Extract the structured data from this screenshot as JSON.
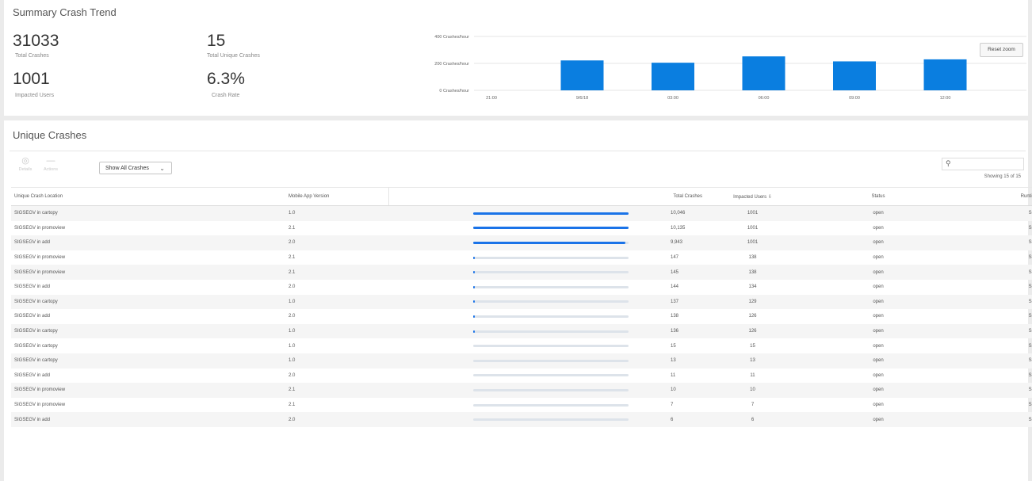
{
  "summary": {
    "title": "Summary Crash Trend",
    "stats": {
      "total_crashes": {
        "value": "31033",
        "label": "Total Crashes"
      },
      "unique_crashes": {
        "value": "15",
        "label": "Total Unique Crashes"
      },
      "impacted_users": {
        "value": "1001",
        "label": "Impacted Users"
      },
      "crash_rate": {
        "value": "6.3%",
        "label": "Crash Rate"
      }
    },
    "reset_zoom_label": "Reset zoom"
  },
  "chart_data": {
    "type": "bar",
    "title": "",
    "categories": [
      "9/6/18",
      "03:00",
      "06:00",
      "09:00",
      "12:00"
    ],
    "x_tick_labels": [
      "21:00",
      "9/6/18",
      "03:00",
      "06:00",
      "09:00",
      "12:00"
    ],
    "y_tick_labels": [
      "400 Crashes/hour",
      "200 Crashes/hour",
      "0 Crashes/hour"
    ],
    "values": [
      222,
      205,
      252,
      215,
      230
    ],
    "ylim": [
      0,
      400
    ],
    "grid": true,
    "bar_color": "#0a7ee0"
  },
  "crashes": {
    "title": "Unique Crashes",
    "toolbar": {
      "details_label": "Details",
      "actions_label": "Actions",
      "filter_label": "Show All Crashes",
      "search_placeholder": "",
      "showing_text": "Showing 15 of 15"
    },
    "columns": {
      "location": "Unique Crash Location",
      "version": "Mobile App Version",
      "total": "Total Crashes",
      "impacted": "Impacted Users ⇩",
      "status": "Status",
      "runtime": "Runtime"
    },
    "rows": [
      {
        "location": "SIGSEGV in cartopy",
        "version": "1.0",
        "total": "10,046",
        "fraction": 1.0,
        "impacted": "1001",
        "status": "open",
        "runtime": "SDK"
      },
      {
        "location": "SIGSEGV in promoview",
        "version": "2.1",
        "total": "10,135",
        "fraction": 1.0,
        "impacted": "1001",
        "status": "open",
        "runtime": "SDK"
      },
      {
        "location": "SIGSEGV in add",
        "version": "2.0",
        "total": "9,943",
        "fraction": 0.98,
        "impacted": "1001",
        "status": "open",
        "runtime": "SDK"
      },
      {
        "location": "SIGSEGV in promoview",
        "version": "2.1",
        "total": "147",
        "fraction": 0.015,
        "impacted": "138",
        "status": "open",
        "runtime": "SDK"
      },
      {
        "location": "SIGSEGV in promoview",
        "version": "2.1",
        "total": "145",
        "fraction": 0.015,
        "impacted": "138",
        "status": "open",
        "runtime": "SDK"
      },
      {
        "location": "SIGSEGV in add",
        "version": "2.0",
        "total": "144",
        "fraction": 0.014,
        "impacted": "134",
        "status": "open",
        "runtime": "SDK"
      },
      {
        "location": "SIGSEGV in cartopy",
        "version": "1.0",
        "total": "137",
        "fraction": 0.013,
        "impacted": "129",
        "status": "open",
        "runtime": "SDK"
      },
      {
        "location": "SIGSEGV in add",
        "version": "2.0",
        "total": "138",
        "fraction": 0.013,
        "impacted": "126",
        "status": "open",
        "runtime": "SDK"
      },
      {
        "location": "SIGSEGV in cartopy",
        "version": "1.0",
        "total": "136",
        "fraction": 0.013,
        "impacted": "126",
        "status": "open",
        "runtime": "SDK"
      },
      {
        "location": "SIGSEGV in cartopy",
        "version": "1.0",
        "total": "15",
        "fraction": 0.0,
        "impacted": "15",
        "status": "open",
        "runtime": "SDK"
      },
      {
        "location": "SIGSEGV in cartopy",
        "version": "1.0",
        "total": "13",
        "fraction": 0.0,
        "impacted": "13",
        "status": "open",
        "runtime": "SDK"
      },
      {
        "location": "SIGSEGV in add",
        "version": "2.0",
        "total": "11",
        "fraction": 0.0,
        "impacted": "11",
        "status": "open",
        "runtime": "SDK"
      },
      {
        "location": "SIGSEGV in promoview",
        "version": "2.1",
        "total": "10",
        "fraction": 0.0,
        "impacted": "10",
        "status": "open",
        "runtime": "SDK"
      },
      {
        "location": "SIGSEGV in promoview",
        "version": "2.1",
        "total": "7",
        "fraction": 0.0,
        "impacted": "7",
        "status": "open",
        "runtime": "SDK"
      },
      {
        "location": "SIGSEGV in add",
        "version": "2.0",
        "total": "6",
        "fraction": 0.0,
        "impacted": "6",
        "status": "open",
        "runtime": "SDK"
      }
    ]
  }
}
